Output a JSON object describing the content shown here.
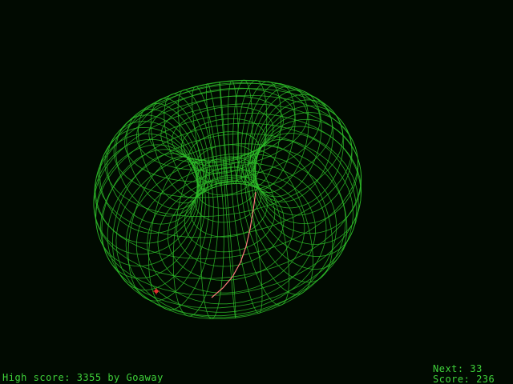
{
  "hud": {
    "high_score_text": "High score: 3355 by Goaway",
    "next_text": "Next: 33",
    "score_text": "Score: 236"
  },
  "colors": {
    "background": "#010a01",
    "wireframe": "#2fbf2a",
    "hud_text": "#3fd23a",
    "worm": "#ff7d7d",
    "food": "#e03030"
  },
  "icons": {
    "food": "target-food-icon",
    "worm": "worm-player-icon"
  }
}
